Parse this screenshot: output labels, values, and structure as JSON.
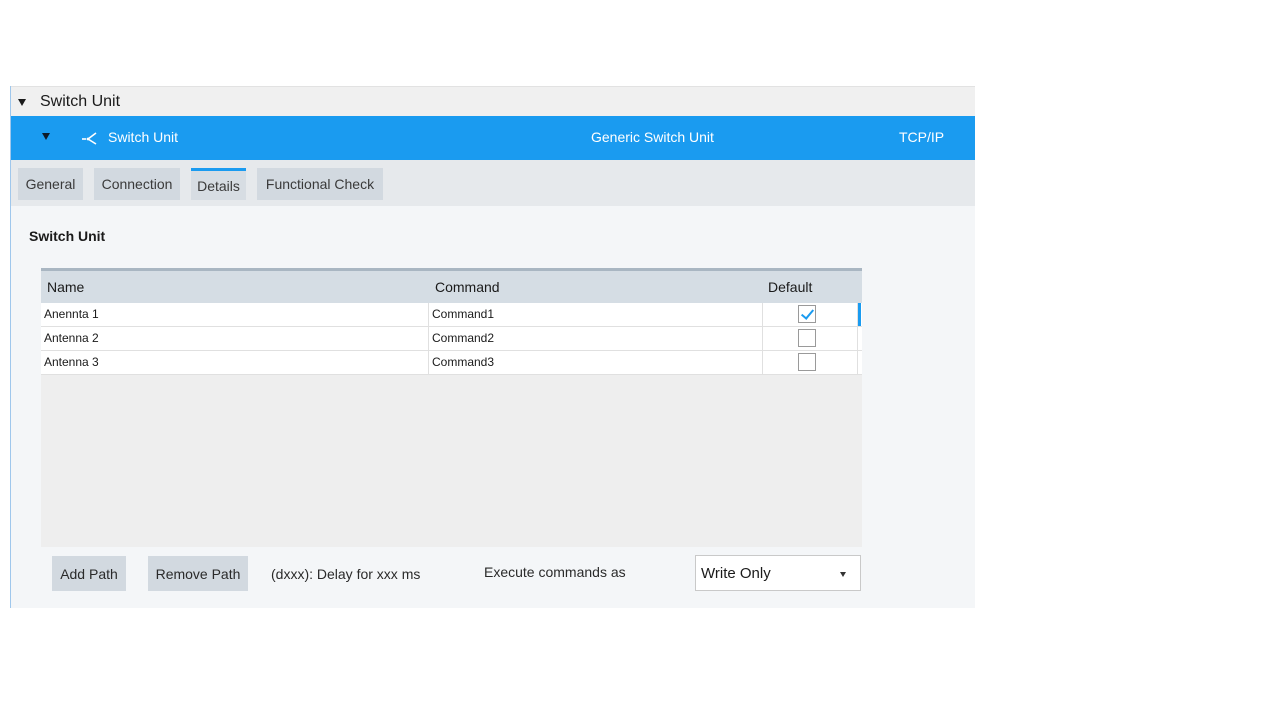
{
  "section": {
    "title": "Switch Unit"
  },
  "device": {
    "name": "Switch Unit",
    "type": "Generic Switch Unit",
    "connection": "TCP/IP"
  },
  "tabs": [
    {
      "label": "General",
      "active": false
    },
    {
      "label": "Connection",
      "active": false
    },
    {
      "label": "Details",
      "active": true
    },
    {
      "label": "Functional Check",
      "active": false
    }
  ],
  "content": {
    "title": "Switch Unit"
  },
  "table": {
    "columns": {
      "name": "Name",
      "command": "Command",
      "default": "Default"
    },
    "rows": [
      {
        "name": "Anennta 1",
        "command": "Command1",
        "default": true
      },
      {
        "name": "Antenna 2",
        "command": "Command2",
        "default": false
      },
      {
        "name": "Antenna 3",
        "command": "Command3",
        "default": false
      }
    ]
  },
  "footer": {
    "add_path_label": "Add Path",
    "remove_path_label": "Remove Path",
    "delay_hint": "(dxxx): Delay for xxx ms",
    "execute_label": "Execute commands as",
    "execute_mode": "Write Only"
  },
  "colors": {
    "accent": "#1a9bf0",
    "tab_background": "#d2d9e0",
    "header_row": "#d5dde4"
  },
  "icons": {
    "section_toggle": "triangle-down-icon",
    "device_toggle": "triangle-down-icon",
    "device_icon": "switch-icon",
    "select_caret": "caret-down-icon",
    "checkbox_checked": "checkmark-icon"
  }
}
